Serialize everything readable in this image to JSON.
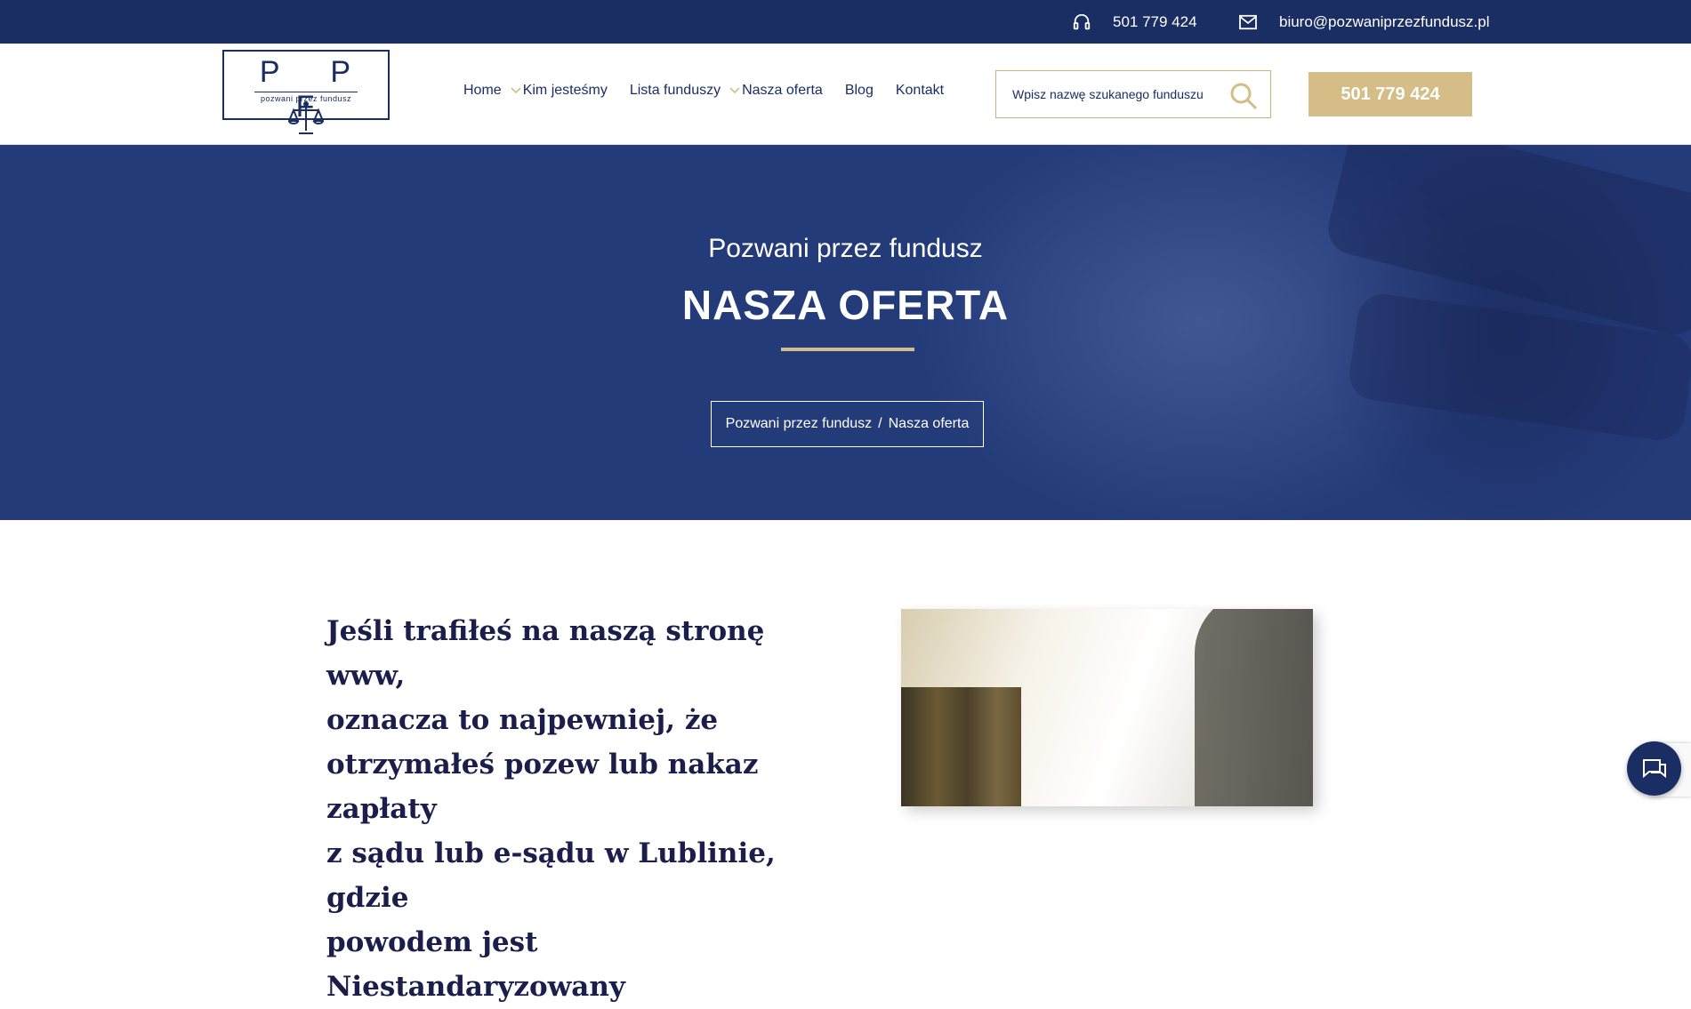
{
  "topbar": {
    "phone": "501 779 424",
    "email": "biuro@pozwaniprzezfundusz.pl",
    "bg_color": "#1b2e63"
  },
  "logo": {
    "letters": "P P F",
    "tagline": "pozwani przez fundusz"
  },
  "nav": {
    "items": [
      {
        "label": "Home",
        "has_dropdown": true
      },
      {
        "label": "Kim jesteśmy",
        "has_dropdown": false
      },
      {
        "label": "Lista funduszy",
        "has_dropdown": true
      },
      {
        "label": "Nasza oferta",
        "has_dropdown": false
      },
      {
        "label": "Blog",
        "has_dropdown": false
      },
      {
        "label": "Kontakt",
        "has_dropdown": false
      }
    ]
  },
  "search": {
    "placeholder": "Wpisz nazwę szukanego funduszu",
    "value": ""
  },
  "call_button": {
    "label": "501 779 424",
    "color": "#d4bd86"
  },
  "hero": {
    "subtitle": "Pozwani przez fundusz",
    "title": "NASZA OFERTA",
    "breadcrumb": [
      "Pozwani przez fundusz",
      "Nasza oferta"
    ],
    "breadcrumb_separator": "/"
  },
  "content": {
    "heading_lines": [
      "Jeśli trafiłeś na naszą stronę www,",
      "oznacza to najpewniej, że",
      "otrzymałeś pozew lub nakaz zapłaty",
      "z sądu lub e-sądu w Lublinie, gdzie",
      "powodem jest Niestandaryzowany"
    ]
  },
  "icons": {
    "phone": "headset-icon",
    "email": "envelope-icon",
    "search": "magnifier-icon",
    "chat": "chat-icon"
  }
}
